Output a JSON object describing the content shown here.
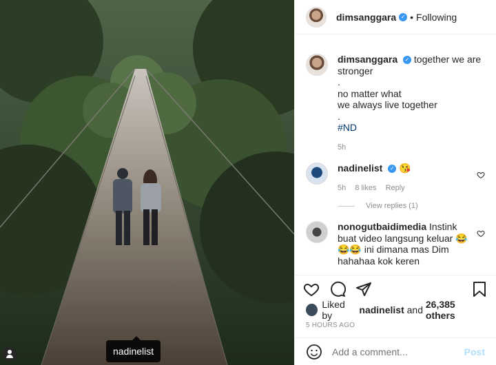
{
  "post": {
    "author": "dimsanggara",
    "follow_status": "Following",
    "separator": "•",
    "caption_lines": [
      "together we are",
      "stronger",
      ".",
      "no matter what",
      "we always live together",
      "."
    ],
    "hashtag": "#ND",
    "caption_time": "5h"
  },
  "photo": {
    "tag_label": "nadinelist"
  },
  "comments": [
    {
      "user": "nadinelist",
      "text": "😘",
      "time": "5h",
      "likes": "8 likes",
      "reply_label": "Reply",
      "view_replies": "View replies (1)"
    },
    {
      "user": "nonogutbaidimedia",
      "text": "Instink buat video langsung keluar 😂 😂😂 ini dimana mas Dim hahahaa kok keren"
    }
  ],
  "likes": {
    "prefix": "Liked by",
    "user": "nadinelist",
    "connector": "and",
    "others": "26,385 others"
  },
  "timestamp": "5 HOURS AGO",
  "composer": {
    "placeholder": "Add a comment...",
    "post_label": "Post"
  },
  "icons": {
    "like": "heart-icon",
    "comment": "comment-icon",
    "share": "share-icon",
    "save": "bookmark-icon",
    "emoji": "emoji-icon",
    "verified": "verified-badge-icon"
  },
  "colors": {
    "verified": "#3897f0",
    "link": "#00376b",
    "muted": "#8e8e8e",
    "post_disabled": "#b2dffc"
  }
}
